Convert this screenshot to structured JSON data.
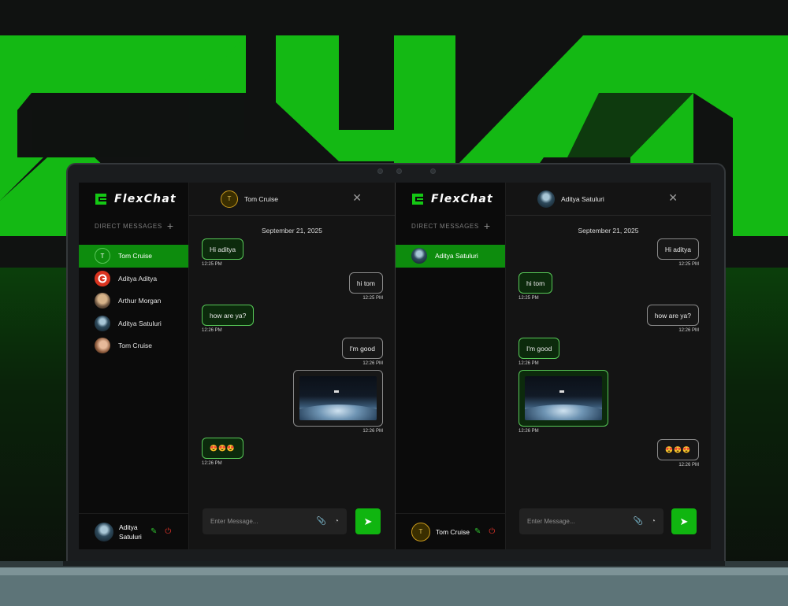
{
  "app_name": "FlexChat",
  "colors": {
    "accent": "#10b510",
    "active_row": "#0d8c0d",
    "bubble_border": "#57c957"
  },
  "left": {
    "sidebar": {
      "section_title": "DIRECT MESSAGES",
      "add_icon": "plus-icon",
      "contacts": [
        {
          "name": "Tom Cruise",
          "avatar": "T",
          "active": true
        },
        {
          "name": "Aditya Aditya",
          "avatar": ""
        },
        {
          "name": "Arthur Morgan",
          "avatar": ""
        },
        {
          "name": "Aditya Satuluri",
          "avatar": ""
        },
        {
          "name": "Tom Cruise",
          "avatar": ""
        }
      ],
      "profile": {
        "name": "Aditya Satuluri"
      }
    },
    "chat": {
      "title": "Tom Cruise",
      "avatar_letter": "T",
      "date": "September 21, 2025",
      "messages": [
        {
          "text": "Hi aditya",
          "time": "12:25 PM"
        },
        {
          "text": "hi tom",
          "time": "12:25 PM"
        },
        {
          "text": "how are ya?",
          "time": "12:26 PM"
        },
        {
          "text": "I'm good",
          "time": "12:26 PM"
        },
        {
          "text": "",
          "time": "12:26 PM"
        },
        {
          "text": "😍😍😍",
          "time": "12:26 PM"
        }
      ],
      "composer": {
        "placeholder": "Enter Message..."
      }
    }
  },
  "right": {
    "sidebar": {
      "section_title": "DIRECT MESSAGES",
      "contacts": [
        {
          "name": "Aditya Satuluri",
          "avatar": "",
          "active": true
        }
      ],
      "profile": {
        "name": "Tom Cruise",
        "avatar_letter": "T"
      }
    },
    "chat": {
      "title": "Aditya Satuluri",
      "date": "September 21, 2025",
      "messages": [
        {
          "text": "Hi aditya",
          "time": "12:25 PM"
        },
        {
          "text": "hi tom",
          "time": "12:25 PM"
        },
        {
          "text": "how are ya?",
          "time": "12:26 PM"
        },
        {
          "text": "I'm good",
          "time": "12:26 PM"
        },
        {
          "text": "",
          "time": "12:26 PM"
        },
        {
          "text": "😍😍😍",
          "time": "12:26 PM"
        }
      ],
      "composer": {
        "placeholder": "Enter Message..."
      }
    }
  }
}
